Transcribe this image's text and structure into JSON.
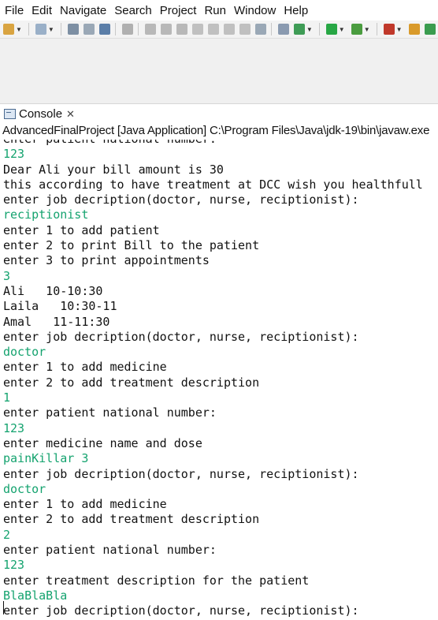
{
  "menu": [
    "File",
    "Edit",
    "Navigate",
    "Search",
    "Project",
    "Run",
    "Window",
    "Help"
  ],
  "toolbar": {
    "icons": [
      {
        "name": "new-wizard-icon",
        "color": "#d9a441"
      },
      {
        "name": "new-java-icon",
        "color": "#9ab0c8"
      },
      {
        "name": "save-icon",
        "color": "#7d8fa3"
      },
      {
        "name": "save-all-icon",
        "color": "#9aa8b6"
      },
      {
        "name": "terminal-icon",
        "color": "#5b7ea8"
      },
      {
        "name": "skip-breakpoints-icon",
        "color": "#b0b0b0"
      },
      {
        "name": "resume-icon",
        "color": "#b8b8b8"
      },
      {
        "name": "suspend-icon",
        "color": "#b8b8b8"
      },
      {
        "name": "terminate-icon",
        "color": "#b8b8b8"
      },
      {
        "name": "disconnect-icon",
        "color": "#c0c0c0"
      },
      {
        "name": "step-into-icon",
        "color": "#c0c0c0"
      },
      {
        "name": "step-over-icon",
        "color": "#c0c0c0"
      },
      {
        "name": "step-return-icon",
        "color": "#c0c0c0"
      },
      {
        "name": "use-step-filters-icon",
        "color": "#9aa8b6"
      },
      {
        "name": "new-task-icon",
        "color": "#8a9ab0"
      },
      {
        "name": "debug-icon",
        "color": "#3f9c56"
      },
      {
        "name": "run-icon",
        "color": "#28a745"
      },
      {
        "name": "coverage-icon",
        "color": "#4a9c3f"
      },
      {
        "name": "external-tools-icon",
        "color": "#c0392b"
      },
      {
        "name": "open-type-icon",
        "color": "#d99a2b"
      },
      {
        "name": "extra-icon",
        "color": "#3a9c4f"
      }
    ]
  },
  "console": {
    "tab_label": "Console",
    "close_glyph": "✕",
    "launch_info": "AdvancedFinalProject [Java Application] C:\\Program Files\\Java\\jdk-19\\bin\\javaw.exe",
    "lines": [
      {
        "text": "enter patient national number:",
        "kind": "output"
      },
      {
        "text": "123",
        "kind": "input"
      },
      {
        "text": "Dear Ali your bill amount is 30",
        "kind": "output"
      },
      {
        "text": "this according to have treatment at DCC wish you healthfull",
        "kind": "output"
      },
      {
        "text": "enter job decription(doctor, nurse, reciptionist):",
        "kind": "output"
      },
      {
        "text": "reciptionist",
        "kind": "input"
      },
      {
        "text": "enter 1 to add patient",
        "kind": "output"
      },
      {
        "text": "enter 2 to print Bill to the patient",
        "kind": "output"
      },
      {
        "text": "enter 3 to print appointments",
        "kind": "output"
      },
      {
        "text": "3",
        "kind": "input"
      },
      {
        "text": "Ali   10-10:30",
        "kind": "output"
      },
      {
        "text": "Laila   10:30-11",
        "kind": "output"
      },
      {
        "text": "Amal   11-11:30",
        "kind": "output"
      },
      {
        "text": "enter job decription(doctor, nurse, reciptionist):",
        "kind": "output"
      },
      {
        "text": "doctor",
        "kind": "input"
      },
      {
        "text": "enter 1 to add medicine",
        "kind": "output"
      },
      {
        "text": "enter 2 to add treatment description",
        "kind": "output"
      },
      {
        "text": "1",
        "kind": "input"
      },
      {
        "text": "enter patient national number:",
        "kind": "output"
      },
      {
        "text": "123",
        "kind": "input"
      },
      {
        "text": "enter medicine name and dose",
        "kind": "output"
      },
      {
        "text": "painKillar 3",
        "kind": "input"
      },
      {
        "text": "enter job decription(doctor, nurse, reciptionist):",
        "kind": "output"
      },
      {
        "text": "doctor",
        "kind": "input"
      },
      {
        "text": "enter 1 to add medicine",
        "kind": "output"
      },
      {
        "text": "enter 2 to add treatment description",
        "kind": "output"
      },
      {
        "text": "2",
        "kind": "input"
      },
      {
        "text": "enter patient national number:",
        "kind": "output"
      },
      {
        "text": "123",
        "kind": "input"
      },
      {
        "text": "enter treatment description for the patient",
        "kind": "output"
      },
      {
        "text": "BlaBlaBla",
        "kind": "input"
      },
      {
        "text": "enter job decription(doctor, nurse, reciptionist):",
        "kind": "output"
      }
    ]
  },
  "colors": {
    "input_text": "#15a36f",
    "output_text": "#111111"
  }
}
